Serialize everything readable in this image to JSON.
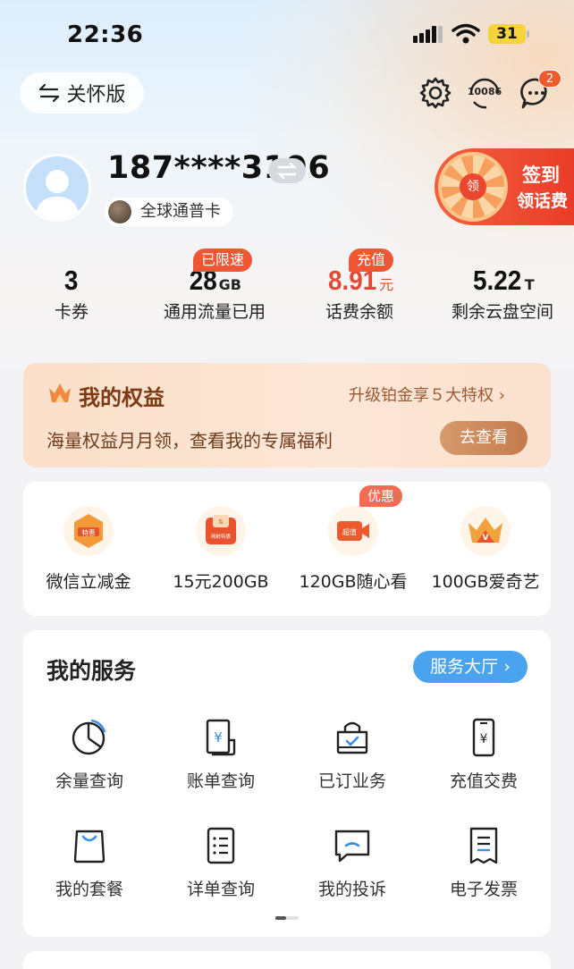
{
  "status_bar": {
    "time": "22:36",
    "battery": "31"
  },
  "header": {
    "care_mode_label": "关怀版",
    "service_hotline_label": "10086",
    "message_badge": "2"
  },
  "profile": {
    "phone": "187****3196",
    "card_type": "全球通普卡"
  },
  "promo": {
    "line1": "签到",
    "line2": "领话费",
    "wheel_center": "领"
  },
  "stats": [
    {
      "value": "3",
      "unit": "",
      "label": "卡券",
      "tag": ""
    },
    {
      "value": "28",
      "unit": "GB",
      "label": "通用流量已用",
      "tag": "已限速"
    },
    {
      "value": "8.91",
      "unit": "元",
      "label": "话费余额",
      "tag": "充值"
    },
    {
      "value": "5.22",
      "unit": "T",
      "label": "剩余云盘空间",
      "tag": ""
    }
  ],
  "benefits": {
    "title": "我的权益",
    "upgrade_link": "升级铂金享５大特权 ›",
    "subtitle": "海量权益月月领，查看我的专属福利",
    "button": "去查看"
  },
  "offers": {
    "tag": "优惠",
    "items": [
      {
        "label": "微信立减金",
        "icon": "discount-badge-icon",
        "icon_text": "特惠"
      },
      {
        "label": "15元200GB",
        "icon": "data-package-icon",
        "icon_text": "网龄特惠"
      },
      {
        "label": "120GB随心看",
        "icon": "video-icon",
        "icon_text": "超值"
      },
      {
        "label": "100GB爱奇艺",
        "icon": "vip-crown-icon",
        "icon_text": "V"
      }
    ]
  },
  "services": {
    "title": "我的服务",
    "hall_button": "服务大厅 ›",
    "items": [
      {
        "label": "余量查询",
        "icon": "pie-chart-icon"
      },
      {
        "label": "账单查询",
        "icon": "bill-icon"
      },
      {
        "label": "已订业务",
        "icon": "subscribed-bag-icon"
      },
      {
        "label": "充值交费",
        "icon": "phone-payment-icon"
      },
      {
        "label": "我的套餐",
        "icon": "package-bag-icon"
      },
      {
        "label": "详单查询",
        "icon": "detail-list-icon"
      },
      {
        "label": "我的投诉",
        "icon": "complaint-chat-icon"
      },
      {
        "label": "电子发票",
        "icon": "invoice-icon"
      }
    ]
  }
}
